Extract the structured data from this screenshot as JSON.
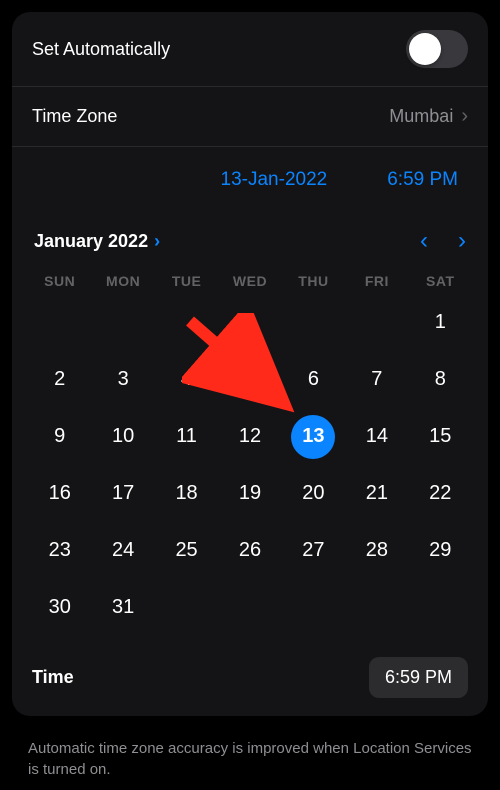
{
  "settings": {
    "set_automatically_label": "Set Automatically",
    "time_zone_label": "Time Zone",
    "time_zone_value": "Mumbai",
    "selected_date": "13-Jan-2022",
    "selected_time": "6:59 PM",
    "time_label": "Time",
    "time_value": "6:59 PM"
  },
  "calendar": {
    "header": "January 2022",
    "weekdays": [
      "SUN",
      "MON",
      "TUE",
      "WED",
      "THU",
      "FRI",
      "SAT"
    ],
    "leading_blanks": 6,
    "days_in_month": 31,
    "selected_day": 13
  },
  "footer": {
    "note": "Automatic time zone accuracy is improved when Location Services is turned on."
  },
  "colors": {
    "accent": "#0a84ff",
    "panel": "#141416",
    "muted": "#8e8e93"
  }
}
